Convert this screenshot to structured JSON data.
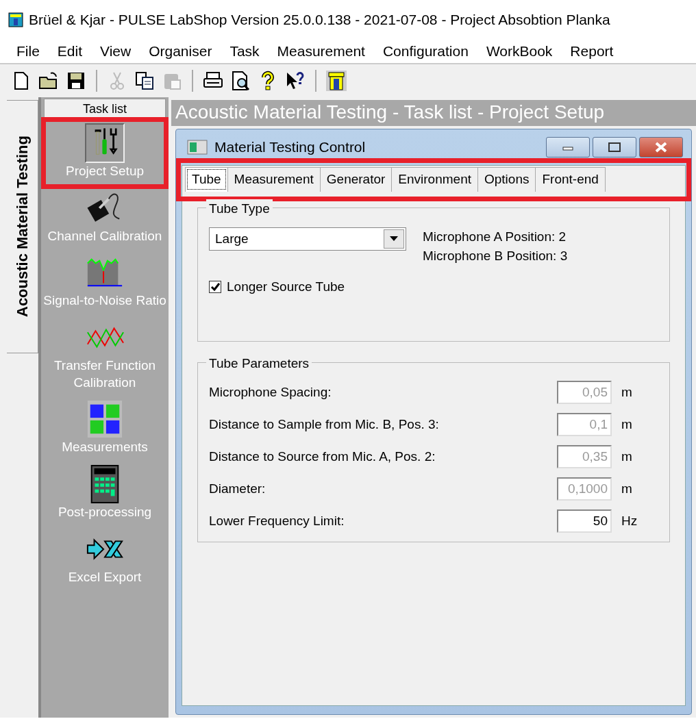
{
  "window": {
    "title": "Brüel & Kjar - PULSE LabShop  Version 25.0.0.138 - 2021-07-08 - Project Absobtion Planka"
  },
  "menu": [
    "File",
    "Edit",
    "View",
    "Organiser",
    "Task",
    "Measurement",
    "Configuration",
    "WorkBook",
    "Report"
  ],
  "toolbar": [
    {
      "kind": "new",
      "disabled": false
    },
    {
      "kind": "open",
      "disabled": false
    },
    {
      "kind": "save",
      "disabled": false
    },
    {
      "kind": "sep"
    },
    {
      "kind": "cut",
      "disabled": true
    },
    {
      "kind": "copy",
      "disabled": false
    },
    {
      "kind": "paste",
      "disabled": true
    },
    {
      "kind": "sep"
    },
    {
      "kind": "print",
      "disabled": false
    },
    {
      "kind": "preview",
      "disabled": false
    },
    {
      "kind": "help",
      "disabled": false
    },
    {
      "kind": "whatsthis",
      "disabled": false
    },
    {
      "kind": "sep"
    },
    {
      "kind": "labshop",
      "disabled": false
    }
  ],
  "side_tab": {
    "label": "Acoustic Material Testing"
  },
  "task_list": {
    "title": "Task list",
    "items": [
      {
        "kind": "tools",
        "label": "Project Setup",
        "selected": true,
        "highlighted": true
      },
      {
        "kind": "probe",
        "label": "Channel Calibration",
        "selected": false,
        "highlighted": false
      },
      {
        "kind": "snr",
        "label": "Signal-to-Noise Ratio",
        "selected": false,
        "highlighted": false
      },
      {
        "kind": "transfer",
        "label": "Transfer Function Calibration",
        "selected": false,
        "highlighted": false
      },
      {
        "kind": "letters",
        "label": "Measurements",
        "selected": false,
        "highlighted": false
      },
      {
        "kind": "calculator",
        "label": "Post-processing",
        "selected": false,
        "highlighted": false
      },
      {
        "kind": "export",
        "label": "Excel Export",
        "selected": false,
        "highlighted": false
      }
    ]
  },
  "view_title": "Acoustic Material Testing - Task list - Project Setup",
  "dialog": {
    "title": "Material Testing Control",
    "tabs_highlighted": true,
    "tabs": [
      {
        "label": "Tube",
        "selected": true
      },
      {
        "label": "Measurement",
        "selected": false
      },
      {
        "label": "Generator",
        "selected": false
      },
      {
        "label": "Environment",
        "selected": false
      },
      {
        "label": "Options",
        "selected": false
      },
      {
        "label": "Front-end",
        "selected": false
      }
    ],
    "tube_type": {
      "legend": "Tube Type",
      "value": "Large",
      "mic_a": "Microphone A Position: 2",
      "mic_b": "Microphone B Position: 3",
      "checkbox": {
        "label": "Longer Source Tube",
        "checked": true
      }
    },
    "tube_parameters": {
      "legend": "Tube Parameters",
      "rows": [
        {
          "label": "Microphone Spacing:",
          "value": "0,05",
          "unit": "m",
          "disabled": true
        },
        {
          "label": "Distance to Sample from Mic. B, Pos. 3:",
          "value": "0,1",
          "unit": "m",
          "disabled": true
        },
        {
          "label": "Distance to Source from Mic. A, Pos. 2:",
          "value": "0,35",
          "unit": "m",
          "disabled": true
        },
        {
          "label": "Diameter:",
          "value": "0,1000",
          "unit": "m",
          "disabled": true
        },
        {
          "label": "Lower Frequency Limit:",
          "value": "50",
          "unit": "Hz",
          "disabled": false
        }
      ]
    }
  }
}
